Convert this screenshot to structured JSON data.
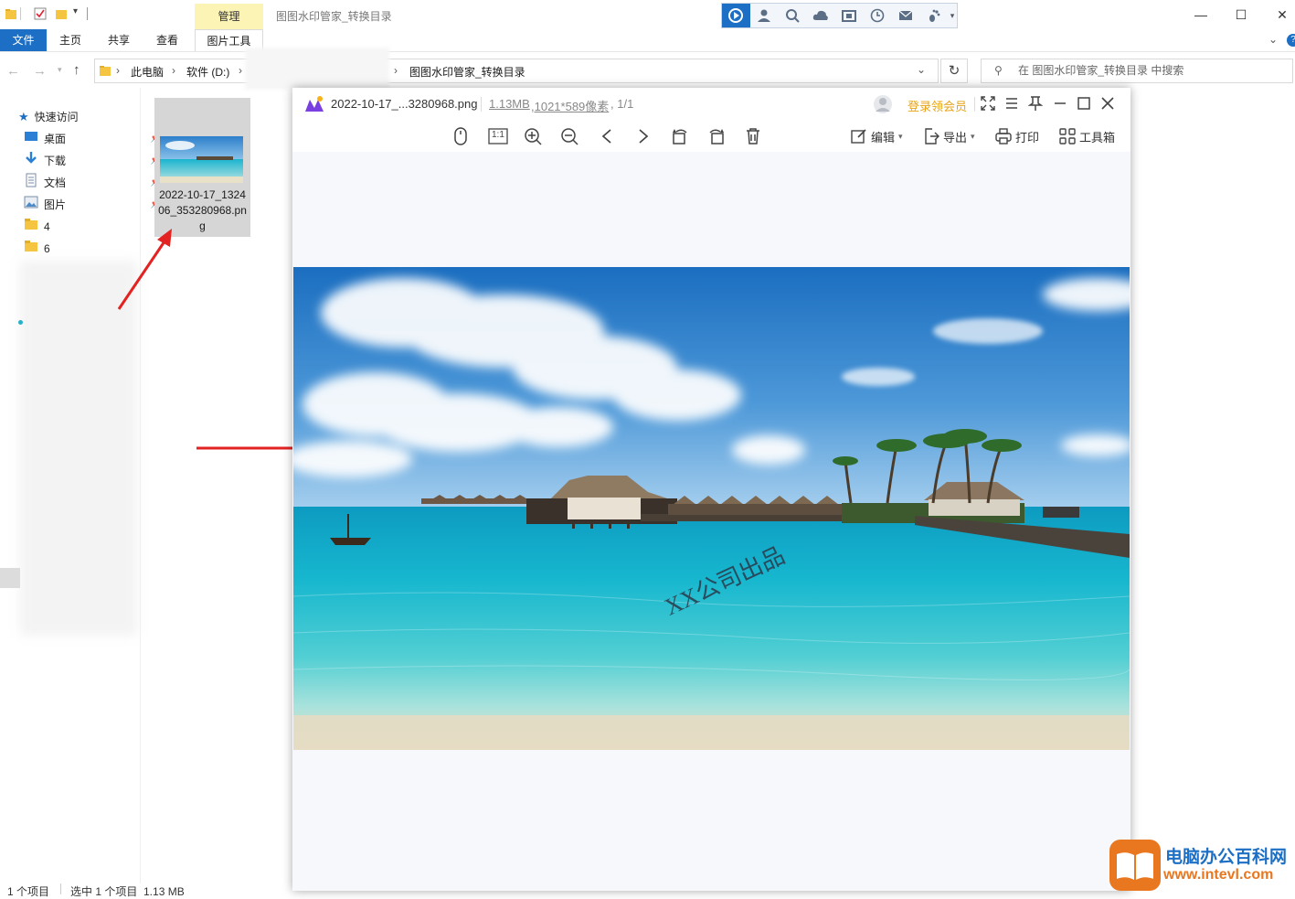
{
  "explorer": {
    "title": "图图水印管家_转换目录",
    "manage_tab": "管理",
    "ribbon_tabs": [
      "文件",
      "主页",
      "共享",
      "查看",
      "图片工具"
    ],
    "breadcrumb": [
      "此电脑",
      "软件 (D:)",
      "图图水印管家_转换目录"
    ],
    "search_placeholder": "在 图图水印管家_转换目录 中搜索",
    "nav": {
      "quick_access": "快速访问",
      "items": [
        "桌面",
        "下载",
        "文档",
        "图片",
        "4",
        "6"
      ]
    },
    "file": {
      "name": "2022-10-17_132406_353280968.png"
    },
    "status": {
      "count": "1 个项目",
      "selected": "选中 1 个项目  1.13 MB"
    }
  },
  "viewer": {
    "filename": "2022-10-17_...3280968.png",
    "filesize": "1.13MB",
    "dimensions": ",1021*589像素",
    "page": ", 1/1",
    "login": "登录领会员",
    "tools": {
      "ratio": "1:1",
      "edit": "编辑",
      "export": "导出",
      "print": "打印",
      "toolbox": "工具箱"
    },
    "watermark_text": "XX公司出品"
  },
  "brand": {
    "line1": "电脑办公百科网",
    "line2": "www.intevl.com"
  },
  "colors": {
    "accent": "#1c6fc4",
    "vip": "#e8a317",
    "arrow": "#e32222",
    "brand_orange": "#e8771f"
  }
}
